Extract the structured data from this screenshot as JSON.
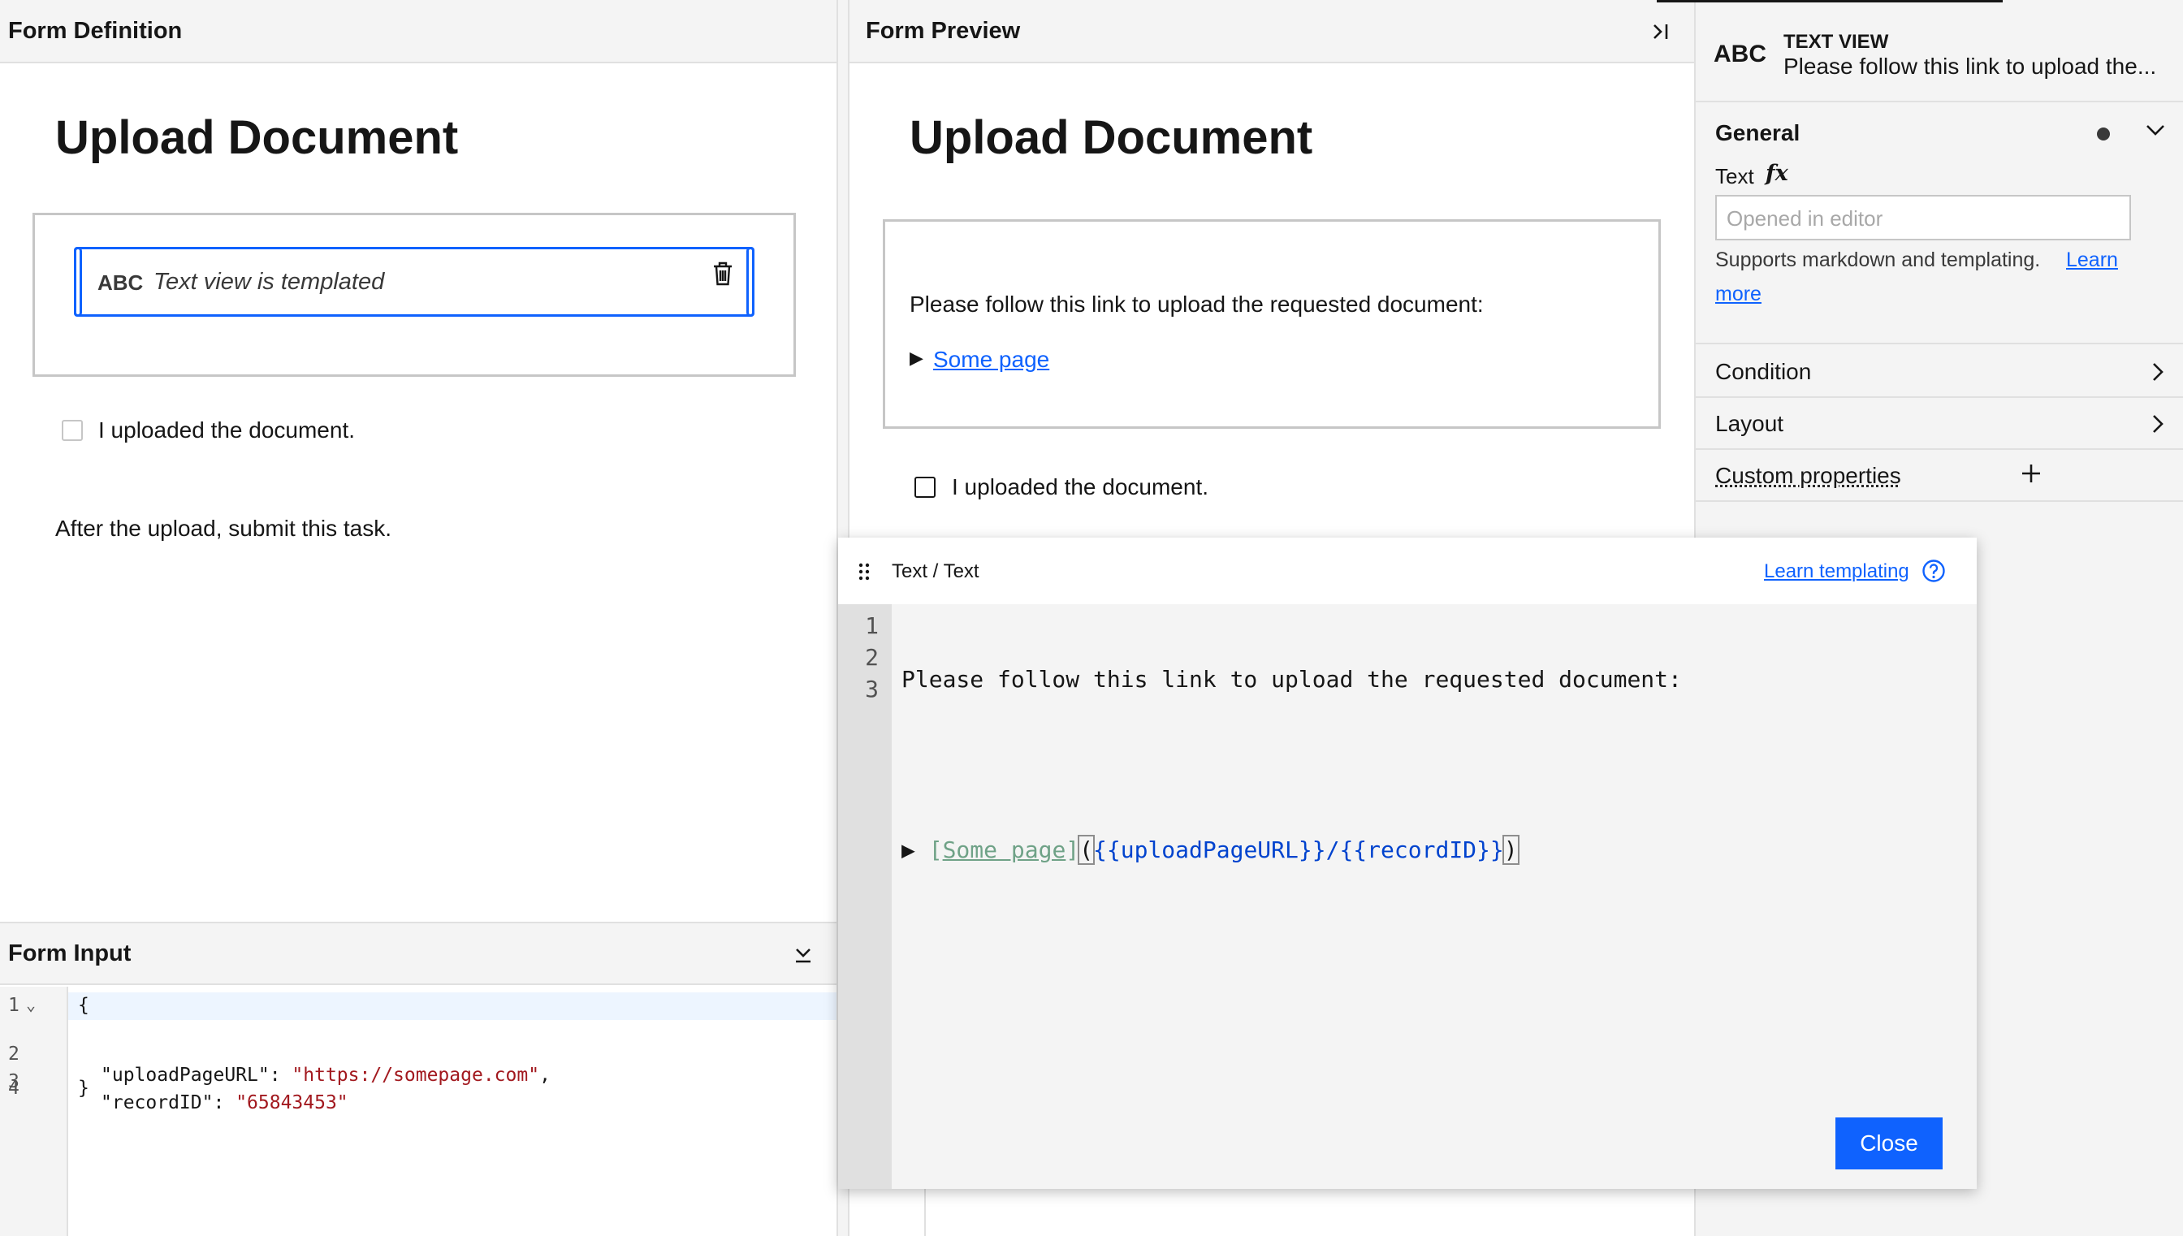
{
  "form_definition": {
    "header": "Form Definition",
    "title": "Upload Document",
    "text_view_badge": "ABC",
    "text_view_label": "Text view is templated",
    "checkbox_label": "I uploaded the document.",
    "footer_text": "After the upload, submit this task."
  },
  "form_input": {
    "header": "Form Input",
    "lines": [
      {
        "num": "1",
        "marker": "⌄",
        "code": "{"
      },
      {
        "num": "2",
        "marker": "",
        "key": "\"uploadPageURL\"",
        "sep": ": ",
        "value": "\"https://somepage.com\"",
        "trail": ","
      },
      {
        "num": "3",
        "marker": "",
        "key": "\"recordID\"",
        "sep": ": ",
        "value": "\"65843453\"",
        "trail": ""
      },
      {
        "num": "4",
        "marker": "",
        "code": "}"
      }
    ]
  },
  "form_preview": {
    "header": "Form Preview",
    "title": "Upload Document",
    "instruction": "Please follow this link to upload the requested document:",
    "bullet": "▶",
    "link_text": "Some page",
    "checkbox_label": "I uploaded the document."
  },
  "properties": {
    "badge": "ABC",
    "type_label": "TEXT VIEW",
    "summary": "Please follow this link to upload the...",
    "general_label": "General",
    "text_label": "Text",
    "fx_label": "fx",
    "text_placeholder": "Opened in editor",
    "helper_text": "Supports markdown and templating.",
    "learn_more_1": "Learn",
    "learn_more_2": "more",
    "condition_label": "Condition",
    "layout_label": "Layout",
    "custom_label": "Custom properties"
  },
  "editor": {
    "breadcrumb": "Text / Text",
    "learn_link": "Learn templating",
    "line_numbers": [
      "1",
      "2",
      "3"
    ],
    "line1": "Please follow this link to upload the requested document:",
    "line3_prefix": "▶ ",
    "line3_bracket_open": "[",
    "line3_link_text": "Some page",
    "line3_bracket_close": "]",
    "line3_paren_open": "(",
    "line3_url_var": "{{uploadPageURL}}",
    "line3_slash": "/",
    "line3_id_var": "{{recordID}}",
    "line3_paren_close": ")",
    "close_label": "Close"
  }
}
